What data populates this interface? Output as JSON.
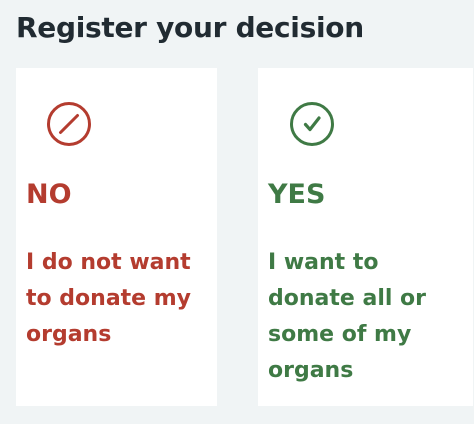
{
  "page": {
    "title": "Register your decision"
  },
  "colors": {
    "background": "#f0f4f5",
    "card": "#ffffff",
    "no": "#b43c2f",
    "yes": "#3f7a45",
    "title": "#212b32"
  },
  "options": {
    "no": {
      "icon": "prohibited-icon",
      "heading": "NO",
      "description": "I do not want to donate my organs"
    },
    "yes": {
      "icon": "check-circle-icon",
      "heading": "YES",
      "description": "I want to donate all or some of my organs"
    }
  }
}
